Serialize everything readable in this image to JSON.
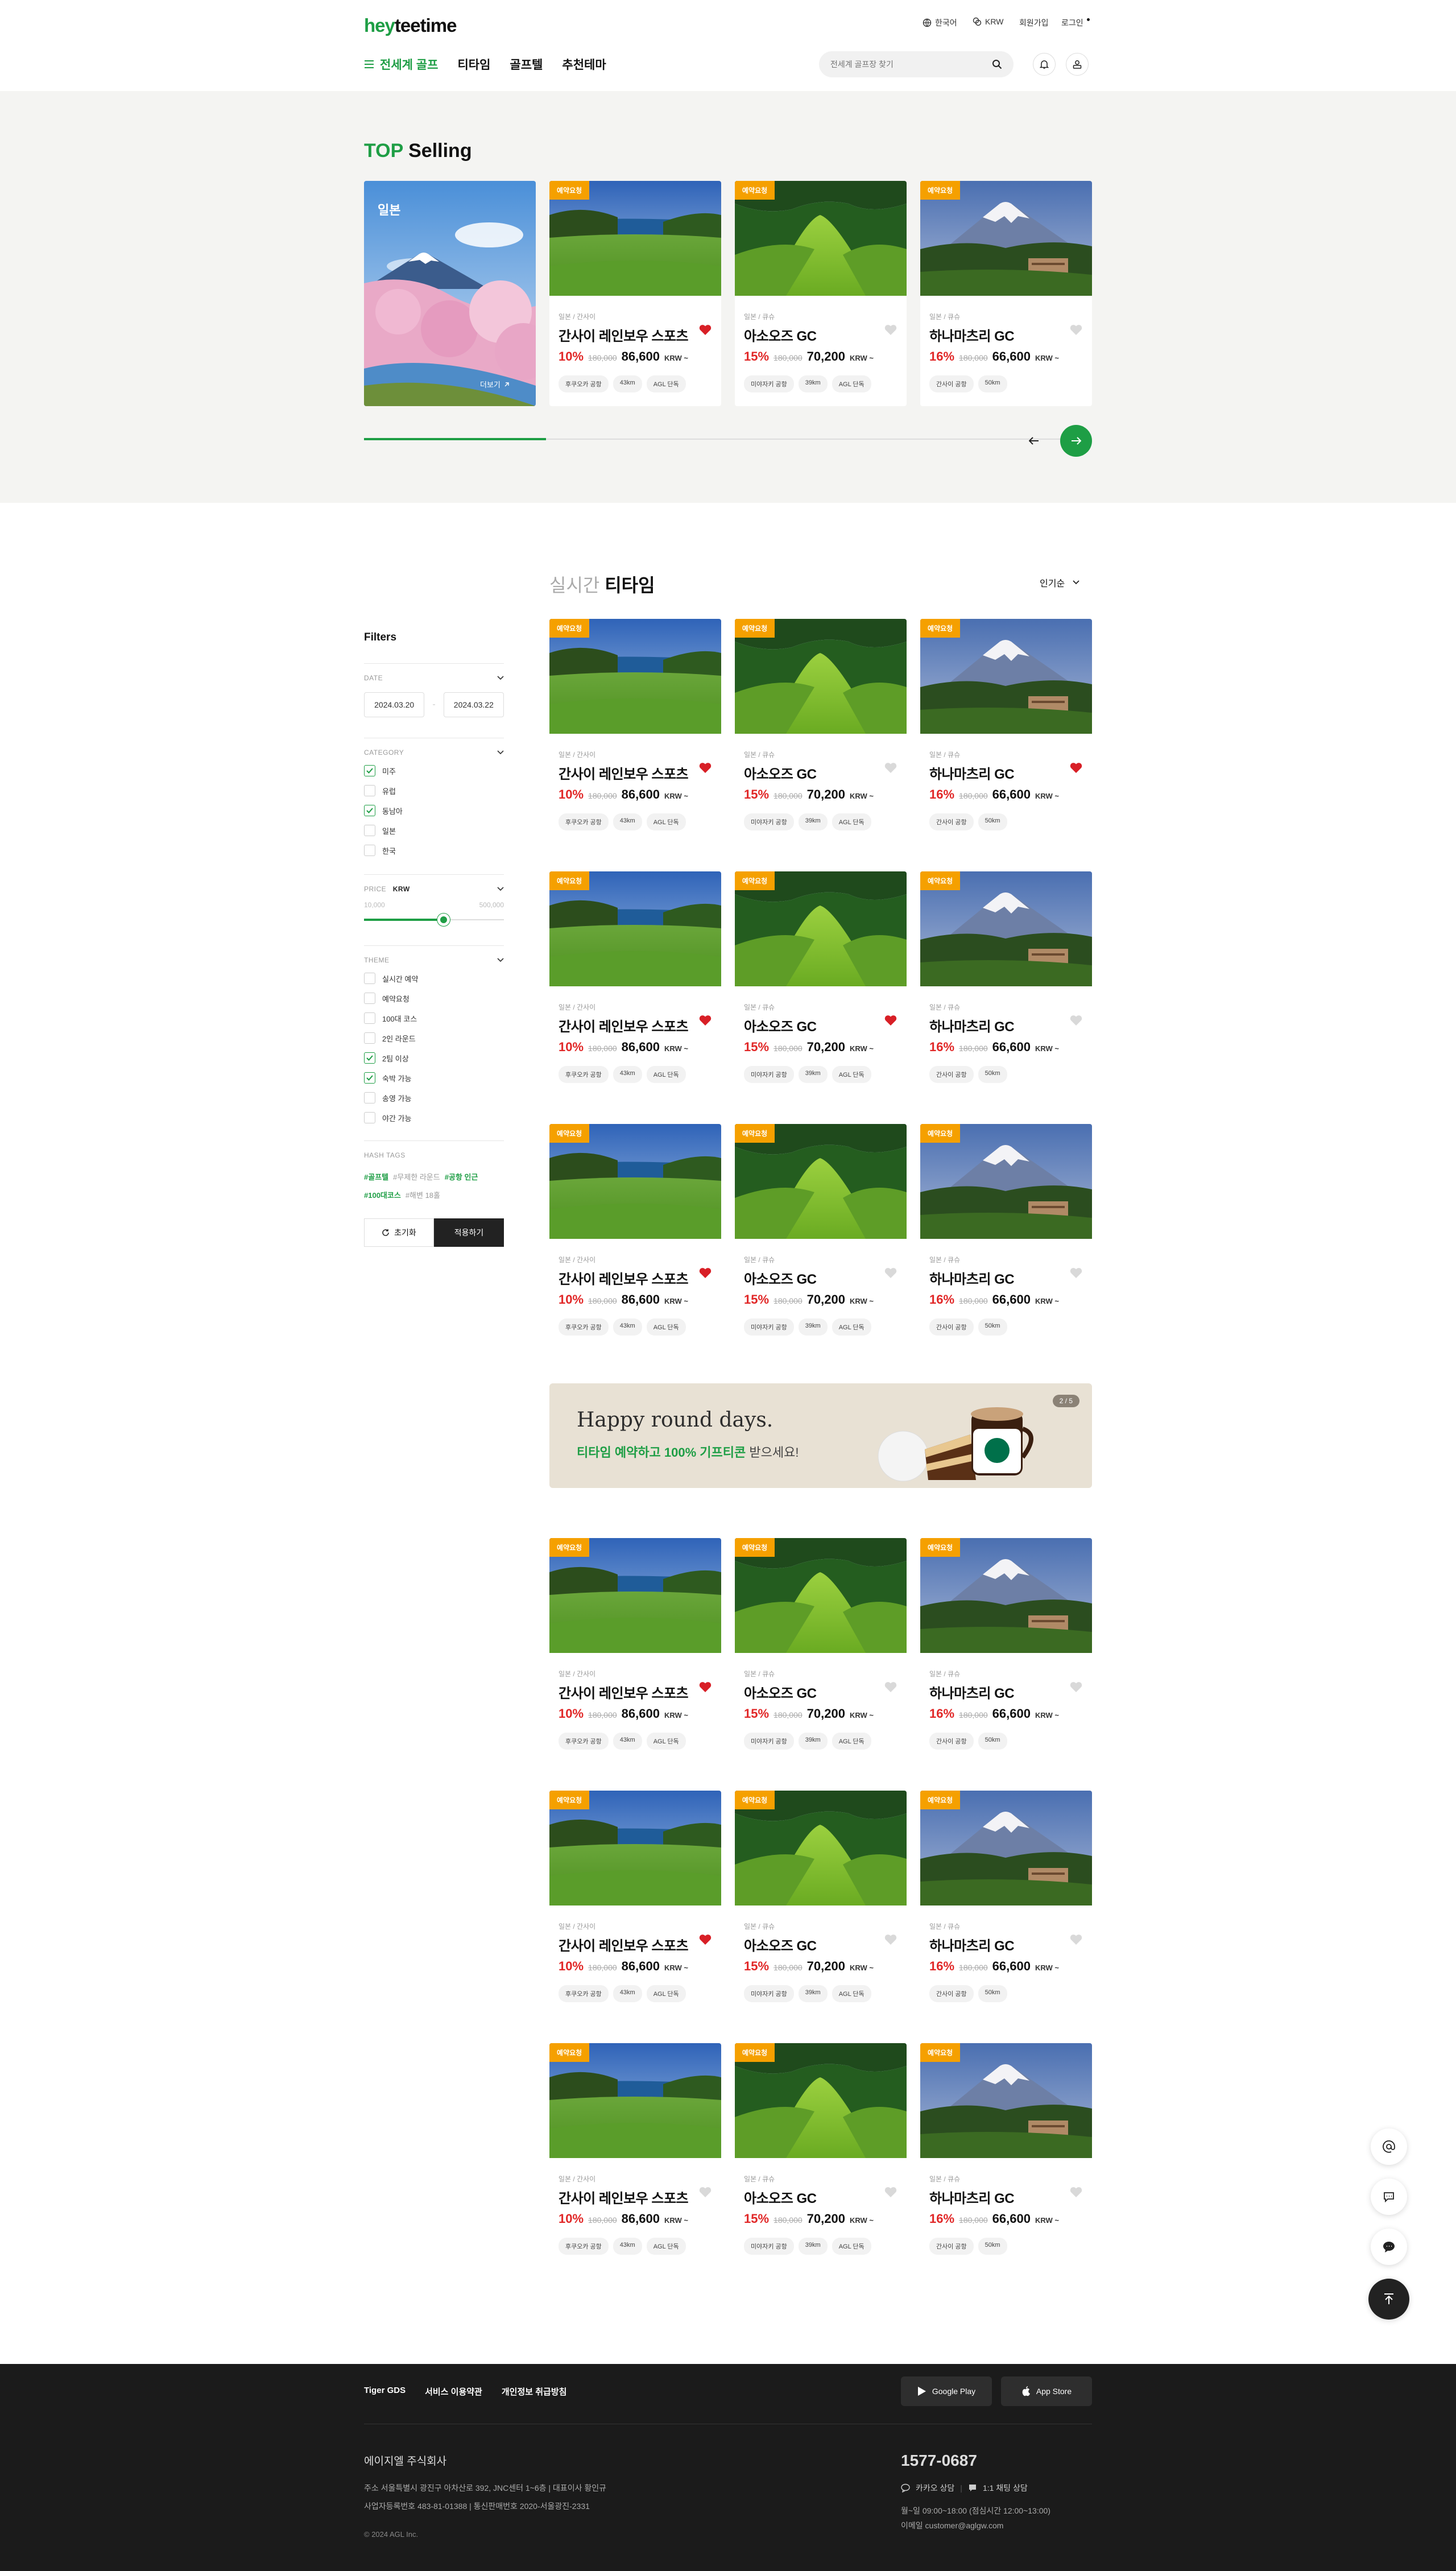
{
  "header": {
    "logo_hey": "hey",
    "logo_teetime": "teetime",
    "language": "한국어",
    "currency": "KRW",
    "signup": "회원가입",
    "login": "로그인",
    "nav": [
      "전세계 골프",
      "티타임",
      "골프텔",
      "추천테마"
    ],
    "search_placeholder": "전세계 골프장 찾기"
  },
  "top_selling": {
    "title_accent": "TOP",
    "title_rest": "Selling",
    "region_label": "일본",
    "more_label": "더보기",
    "cards": [
      {
        "badge": "예약요청",
        "loc": "일본 / 간사이",
        "name": "간사이 레인보우 스포츠",
        "pct": "10%",
        "old": "180,000",
        "now": "86,600",
        "cur": "KRW ~",
        "tags": [
          "후쿠오카 공항",
          "43km",
          "AGL 단독"
        ],
        "liked": true,
        "img": "sea"
      },
      {
        "badge": "예약요청",
        "loc": "일본 / 큐슈",
        "name": "아소오즈 GC",
        "pct": "15%",
        "old": "180,000",
        "now": "70,200",
        "cur": "KRW ~",
        "tags": [
          "미야자키 공항",
          "39km",
          "AGL 단독"
        ],
        "liked": false,
        "img": "fairway"
      },
      {
        "badge": "예약요청",
        "loc": "일본 / 큐슈",
        "name": "하나마츠리 GC",
        "pct": "16%",
        "old": "180,000",
        "now": "66,600",
        "cur": "KRW ~",
        "tags": [
          "간사이 공항",
          "50km"
        ],
        "liked": false,
        "img": "fuji"
      }
    ]
  },
  "filters": {
    "title": "Filters",
    "date_label": "DATE",
    "date_from": "2024.03.20",
    "date_to": "2024.03.22",
    "category_label": "CATEGORY",
    "categories": [
      {
        "label": "미주",
        "checked": true
      },
      {
        "label": "유럽",
        "checked": false
      },
      {
        "label": "동남아",
        "checked": true
      },
      {
        "label": "일본",
        "checked": false
      },
      {
        "label": "한국",
        "checked": false
      }
    ],
    "price_label": "PRICE",
    "price_currency": "KRW",
    "price_min": "10,000",
    "price_max": "500,000",
    "price_slider_fraction": 0.57,
    "theme_label": "THEME",
    "themes": [
      {
        "label": "실시간 예약",
        "checked": false
      },
      {
        "label": "예약요청",
        "checked": false
      },
      {
        "label": "100대 코스",
        "checked": false
      },
      {
        "label": "2인 라운드",
        "checked": false
      },
      {
        "label": "2팀 이상",
        "checked": true
      },
      {
        "label": "숙박 가능",
        "checked": true
      },
      {
        "label": "송영 가능",
        "checked": false
      },
      {
        "label": "야간 가능",
        "checked": false
      }
    ],
    "hashtag_label": "HASH TAGS",
    "hashtags_row1": [
      {
        "t": "#골프텔",
        "on": true
      },
      {
        "t": "#무제한 라운드",
        "on": false
      },
      {
        "t": "#공항 인근",
        "on": true
      }
    ],
    "hashtags_row2": [
      {
        "t": "#100대코스",
        "on": true
      },
      {
        "t": "#해변 18홀",
        "on": false
      }
    ],
    "reset": "초기화",
    "apply": "적용하기"
  },
  "list": {
    "title_light": "실시간",
    "title_bold": "티타임",
    "sort": "인기순",
    "rows": [
      [
        true,
        false,
        true
      ],
      [
        true,
        true,
        false
      ],
      [
        true,
        false,
        false
      ],
      [
        true,
        false,
        false
      ],
      [
        true,
        false,
        false
      ],
      [
        false,
        false,
        false
      ]
    ]
  },
  "banner": {
    "headline": "Happy round days.",
    "sub_green": "티타임 예약하고 100% 기프티콘",
    "sub_rest": "받으세요!",
    "pager": "2 / 5"
  },
  "footer": {
    "links": [
      "Tiger GDS",
      "서비스 이용약관",
      "개인정보 취급방침"
    ],
    "google_play": "Google Play",
    "app_store": "App Store",
    "company": "에이지엘 주식회사",
    "address": "주소  서울특별시 광진구 아차산로 392, JNC센터 1~6층  |  대표이사  황인규",
    "biz": "사업자등록번호  483-81-01388  |  통신판매번호  2020-서울광진-2331",
    "copyright": "© 2024 AGL Inc.",
    "phone": "1577-0687",
    "kakao": "카카오 상담",
    "chat": "1:1 채팅 상담",
    "hours": "월~일 09:00~18:00 (점심시간 12:00~13:00)",
    "email": "이메일    customer@aglgw.com"
  },
  "colors": {
    "brand": "#1e9e45",
    "badge": "#f5a000",
    "discount": "#e12727",
    "heart": "#d81f26"
  }
}
